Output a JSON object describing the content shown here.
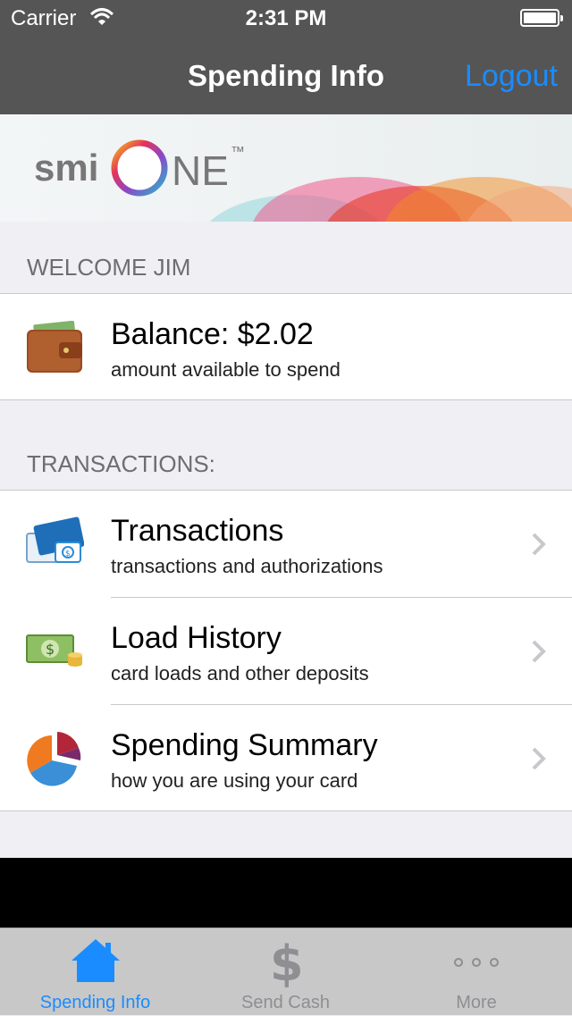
{
  "status_bar": {
    "carrier": "Carrier",
    "time": "2:31 PM"
  },
  "nav": {
    "title": "Spending Info",
    "logout_label": "Logout"
  },
  "banner": {
    "logo_left": "smi",
    "logo_right": "NE",
    "trademark": "™"
  },
  "welcome": {
    "header": "WELCOME JIM"
  },
  "balance": {
    "title": "Balance: $2.02",
    "subtitle": "amount available to spend",
    "icon": "wallet-icon"
  },
  "transactions_section": {
    "header": "TRANSACTIONS:",
    "items": [
      {
        "title": "Transactions",
        "subtitle": "transactions and authorizations",
        "icon": "credit-card-icon"
      },
      {
        "title": "Load History",
        "subtitle": "card loads and other deposits",
        "icon": "money-icon"
      },
      {
        "title": "Spending Summary",
        "subtitle": "how you are using your card",
        "icon": "pie-chart-icon"
      }
    ]
  },
  "tabbar": {
    "tabs": [
      {
        "label": "Spending Info",
        "icon": "home-icon",
        "active": true
      },
      {
        "label": "Send Cash",
        "icon": "dollar-icon",
        "active": false
      },
      {
        "label": "More",
        "icon": "more-icon",
        "active": false
      }
    ]
  },
  "colors": {
    "accent": "#1a8cff",
    "navbar": "#555555",
    "background": "#efeff4"
  }
}
